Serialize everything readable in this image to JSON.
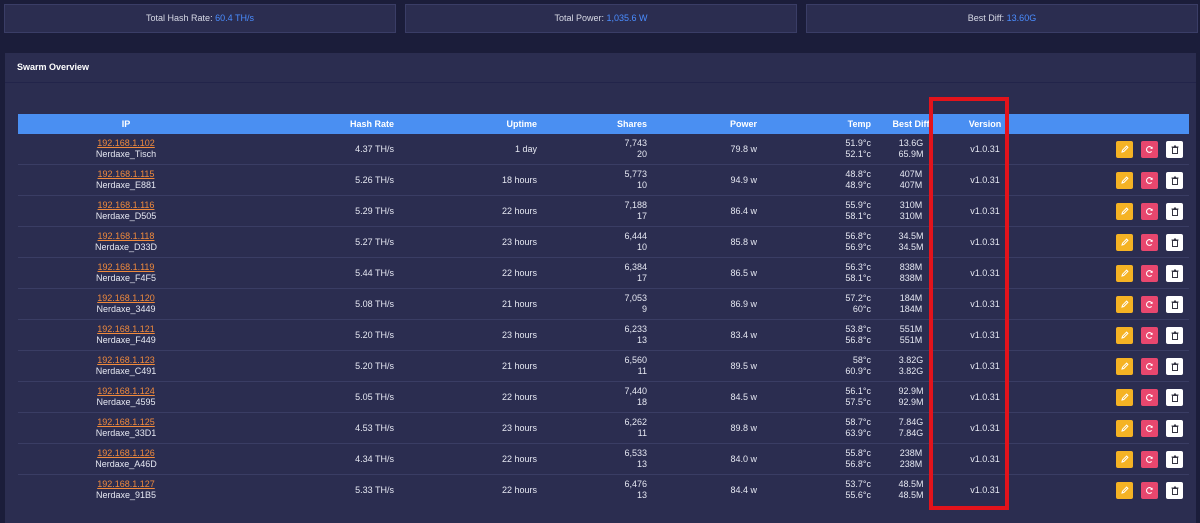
{
  "stats": [
    {
      "label": "Total Hash Rate:",
      "value": "60.4 TH/s"
    },
    {
      "label": "Total Power:",
      "value": "1,035.6 W"
    },
    {
      "label": "Best Diff:",
      "value": "13.60G"
    }
  ],
  "card": {
    "title": "Swarm Overview"
  },
  "table": {
    "headers": [
      "IP",
      "Hash Rate",
      "Uptime",
      "Shares",
      "Power",
      "Temp",
      "Best Diff",
      "Version"
    ],
    "rows": [
      {
        "ip": "192.168.1.102",
        "name": "Nerdaxe_Tisch",
        "hash": "4.37 TH/s",
        "uptime": "1 day",
        "shares1": "7,743",
        "shares2": "20",
        "power": "79.8 w",
        "temp1": "51.9°c",
        "temp2": "52.1°c",
        "diff1": "13.6G",
        "diff2": "65.9M",
        "version": "v1.0.31"
      },
      {
        "ip": "192.168.1.115",
        "name": "Nerdaxe_E881",
        "hash": "5.26 TH/s",
        "uptime": "18 hours",
        "shares1": "5,773",
        "shares2": "10",
        "power": "94.9 w",
        "temp1": "48.8°c",
        "temp2": "48.9°c",
        "diff1": "407M",
        "diff2": "407M",
        "version": "v1.0.31"
      },
      {
        "ip": "192.168.1.116",
        "name": "Nerdaxe_D505",
        "hash": "5.29 TH/s",
        "uptime": "22 hours",
        "shares1": "7,188",
        "shares2": "17",
        "power": "86.4 w",
        "temp1": "55.9°c",
        "temp2": "58.1°c",
        "diff1": "310M",
        "diff2": "310M",
        "version": "v1.0.31"
      },
      {
        "ip": "192.168.1.118",
        "name": "Nerdaxe_D33D",
        "hash": "5.27 TH/s",
        "uptime": "23 hours",
        "shares1": "6,444",
        "shares2": "10",
        "power": "85.8 w",
        "temp1": "56.8°c",
        "temp2": "56.9°c",
        "diff1": "34.5M",
        "diff2": "34.5M",
        "version": "v1.0.31"
      },
      {
        "ip": "192.168.1.119",
        "name": "Nerdaxe_F4F5",
        "hash": "5.44 TH/s",
        "uptime": "22 hours",
        "shares1": "6,384",
        "shares2": "17",
        "power": "86.5 w",
        "temp1": "56.3°c",
        "temp2": "58.1°c",
        "diff1": "838M",
        "diff2": "838M",
        "version": "v1.0.31"
      },
      {
        "ip": "192.168.1.120",
        "name": "Nerdaxe_3449",
        "hash": "5.08 TH/s",
        "uptime": "21 hours",
        "shares1": "7,053",
        "shares2": "9",
        "power": "86.9 w",
        "temp1": "57.2°c",
        "temp2": "60°c",
        "diff1": "184M",
        "diff2": "184M",
        "version": "v1.0.31"
      },
      {
        "ip": "192.168.1.121",
        "name": "Nerdaxe_F449",
        "hash": "5.20 TH/s",
        "uptime": "23 hours",
        "shares1": "6,233",
        "shares2": "13",
        "power": "83.4 w",
        "temp1": "53.8°c",
        "temp2": "56.8°c",
        "diff1": "551M",
        "diff2": "551M",
        "version": "v1.0.31"
      },
      {
        "ip": "192.168.1.123",
        "name": "Nerdaxe_C491",
        "hash": "5.20 TH/s",
        "uptime": "21 hours",
        "shares1": "6,560",
        "shares2": "11",
        "power": "89.5 w",
        "temp1": "58°c",
        "temp2": "60.9°c",
        "diff1": "3.82G",
        "diff2": "3.82G",
        "version": "v1.0.31"
      },
      {
        "ip": "192.168.1.124",
        "name": "Nerdaxe_4595",
        "hash": "5.05 TH/s",
        "uptime": "22 hours",
        "shares1": "7,440",
        "shares2": "18",
        "power": "84.5 w",
        "temp1": "56.1°c",
        "temp2": "57.5°c",
        "diff1": "92.9M",
        "diff2": "92.9M",
        "version": "v1.0.31"
      },
      {
        "ip": "192.168.1.125",
        "name": "Nerdaxe_33D1",
        "hash": "4.53 TH/s",
        "uptime": "23 hours",
        "shares1": "6,262",
        "shares2": "11",
        "power": "89.8 w",
        "temp1": "58.7°c",
        "temp2": "63.9°c",
        "diff1": "7.84G",
        "diff2": "7.84G",
        "version": "v1.0.31"
      },
      {
        "ip": "192.168.1.126",
        "name": "Nerdaxe_A46D",
        "hash": "4.34 TH/s",
        "uptime": "22 hours",
        "shares1": "6,533",
        "shares2": "13",
        "power": "84.0 w",
        "temp1": "55.8°c",
        "temp2": "56.8°c",
        "diff1": "238M",
        "diff2": "238M",
        "version": "v1.0.31"
      },
      {
        "ip": "192.168.1.127",
        "name": "Nerdaxe_91B5",
        "hash": "5.33 TH/s",
        "uptime": "22 hours",
        "shares1": "6,476",
        "shares2": "13",
        "power": "84.4 w",
        "temp1": "53.7°c",
        "temp2": "55.6°c",
        "diff1": "48.5M",
        "diff2": "48.5M",
        "version": "v1.0.31"
      }
    ]
  },
  "actions": {
    "edit_icon": "pencil-icon",
    "restart_icon": "refresh-icon",
    "delete_icon": "trash-icon"
  },
  "colors": {
    "accent": "#4a8ff2",
    "edit": "#f5b324",
    "restart": "#e8476e",
    "highlight": "#e3131b",
    "link": "#f08a3c"
  }
}
